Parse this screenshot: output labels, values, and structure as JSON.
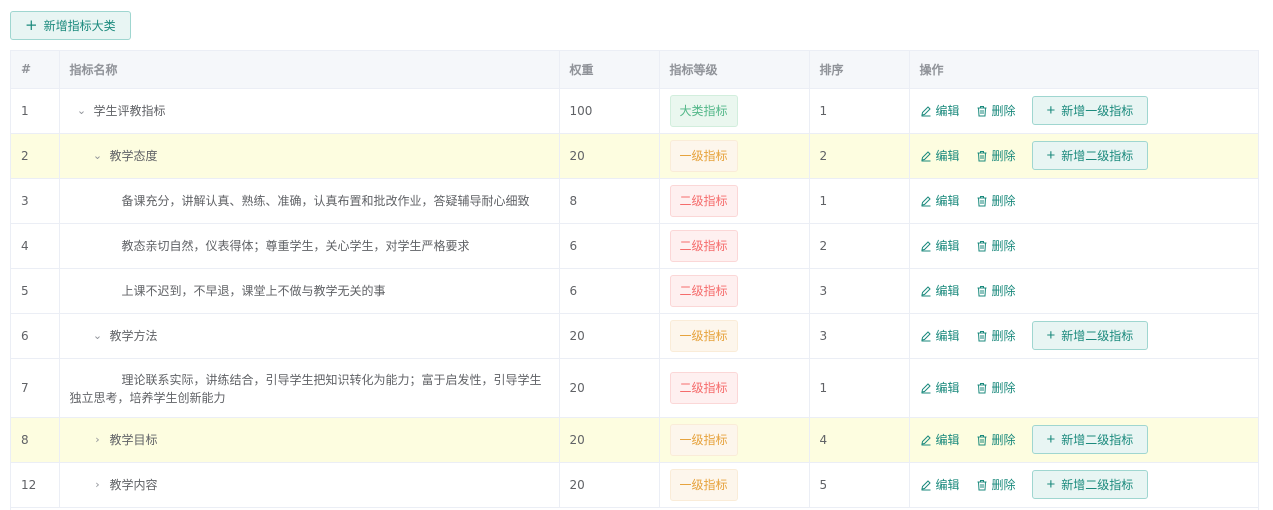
{
  "toolbar": {
    "add_category_label": "新增指标大类"
  },
  "table": {
    "columns": [
      "#",
      "指标名称",
      "权重",
      "指标等级",
      "排序",
      "操作"
    ],
    "edit_label": "编辑",
    "delete_label": "删除",
    "rows": [
      {
        "id": "1",
        "name": "学生评教指标",
        "weight": "100",
        "level": "大类指标",
        "order": "1",
        "add_label": "新增一级指标"
      },
      {
        "id": "2",
        "name": "教学态度",
        "weight": "20",
        "level": "一级指标",
        "order": "2",
        "add_label": "新增二级指标"
      },
      {
        "id": "3",
        "name": "备课充分，讲解认真、熟练、准确，认真布置和批改作业，答疑辅导耐心细致",
        "weight": "8",
        "level": "二级指标",
        "order": "1"
      },
      {
        "id": "4",
        "name": "教态亲切自然，仪表得体；尊重学生，关心学生，对学生严格要求",
        "weight": "6",
        "level": "二级指标",
        "order": "2"
      },
      {
        "id": "5",
        "name": "上课不迟到，不早退，课堂上不做与教学无关的事",
        "weight": "6",
        "level": "二级指标",
        "order": "3"
      },
      {
        "id": "6",
        "name": "教学方法",
        "weight": "20",
        "level": "一级指标",
        "order": "3",
        "add_label": "新增二级指标"
      },
      {
        "id": "7",
        "name": "理论联系实际，讲练结合，引导学生把知识转化为能力；富于启发性，引导学生独立思考，培养学生创新能力",
        "weight": "20",
        "level": "二级指标",
        "order": "1"
      },
      {
        "id": "8",
        "name": "教学目标",
        "weight": "20",
        "level": "一级指标",
        "order": "4",
        "add_label": "新增二级指标"
      },
      {
        "id": "12",
        "name": "教学内容",
        "weight": "20",
        "level": "一级指标",
        "order": "5",
        "add_label": "新增二级指标"
      }
    ]
  },
  "colors": {
    "accent": "#1b8a7d",
    "highlight_row": "#fdfde0"
  }
}
